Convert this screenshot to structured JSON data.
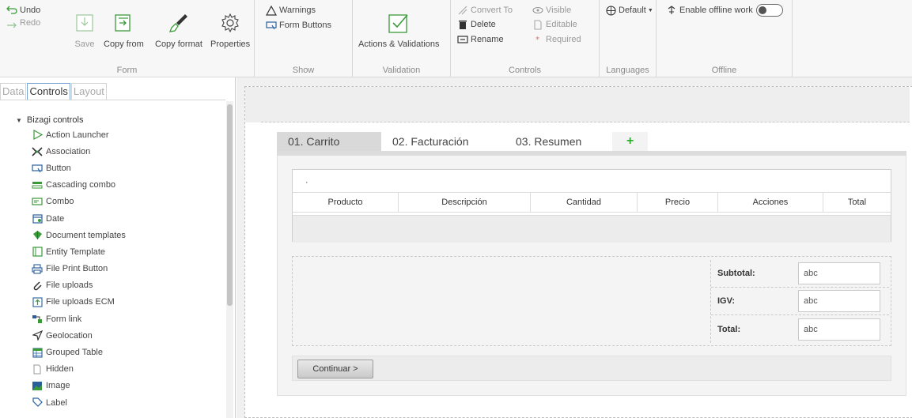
{
  "ribbon": {
    "form": {
      "undo": "Undo",
      "redo": "Redo",
      "save": "Save",
      "copy_from": "Copy from",
      "copy_format": "Copy format",
      "properties": "Properties",
      "label": "Form"
    },
    "show": {
      "warnings": "Warnings",
      "form_buttons": "Form Buttons",
      "label": "Show"
    },
    "validation": {
      "actions": "Actions & Validations",
      "label": "Validation"
    },
    "controls": {
      "convert_to": "Convert To",
      "delete": "Delete",
      "rename": "Rename",
      "visible": "Visible",
      "editable": "Editable",
      "required": "Required",
      "label": "Controls"
    },
    "languages": {
      "default": "Default",
      "label": "Languages"
    },
    "offline": {
      "enable": "Enable offline work",
      "label": "Offline"
    }
  },
  "panel": {
    "tabs": [
      "Data",
      "Controls",
      "Layout"
    ],
    "tree_root": "Bizagi controls",
    "items": [
      {
        "label": "Action Launcher",
        "icon": "action-launcher-icon"
      },
      {
        "label": "Association",
        "icon": "association-icon"
      },
      {
        "label": "Button",
        "icon": "button-icon"
      },
      {
        "label": "Cascading combo",
        "icon": "cascading-combo-icon"
      },
      {
        "label": "Combo",
        "icon": "combo-icon"
      },
      {
        "label": "Date",
        "icon": "date-icon"
      },
      {
        "label": "Document templates",
        "icon": "document-templates-icon"
      },
      {
        "label": "Entity Template",
        "icon": "entity-template-icon"
      },
      {
        "label": "File Print Button",
        "icon": "printer-icon"
      },
      {
        "label": "File uploads",
        "icon": "paperclip-icon"
      },
      {
        "label": "File uploads ECM",
        "icon": "upload-ecm-icon"
      },
      {
        "label": "Form link",
        "icon": "form-link-icon"
      },
      {
        "label": "Geolocation",
        "icon": "geolocation-icon"
      },
      {
        "label": "Grouped Table",
        "icon": "grouped-table-icon"
      },
      {
        "label": "Hidden",
        "icon": "hidden-icon"
      },
      {
        "label": "Image",
        "icon": "image-icon"
      },
      {
        "label": "Label",
        "icon": "label-icon"
      }
    ]
  },
  "form": {
    "tabs": [
      "01. Carrito",
      "02. Facturación",
      "03. Resumen"
    ],
    "add_tab": "+",
    "grid": {
      "caption": "·",
      "columns": [
        "Producto",
        "Descripción",
        "Cantidad",
        "Precio",
        "Acciones",
        "Total"
      ]
    },
    "totals": [
      {
        "label": "Subtotal:",
        "value": "abc"
      },
      {
        "label": "IGV:",
        "value": "abc"
      },
      {
        "label": "Total:",
        "value": "abc"
      }
    ],
    "continue_button": "Continuar >"
  },
  "colors": {
    "accent_green": "#3a9a3a",
    "tab_active": "#d9d9d9",
    "canvas_bg": "#f0f0f0"
  }
}
